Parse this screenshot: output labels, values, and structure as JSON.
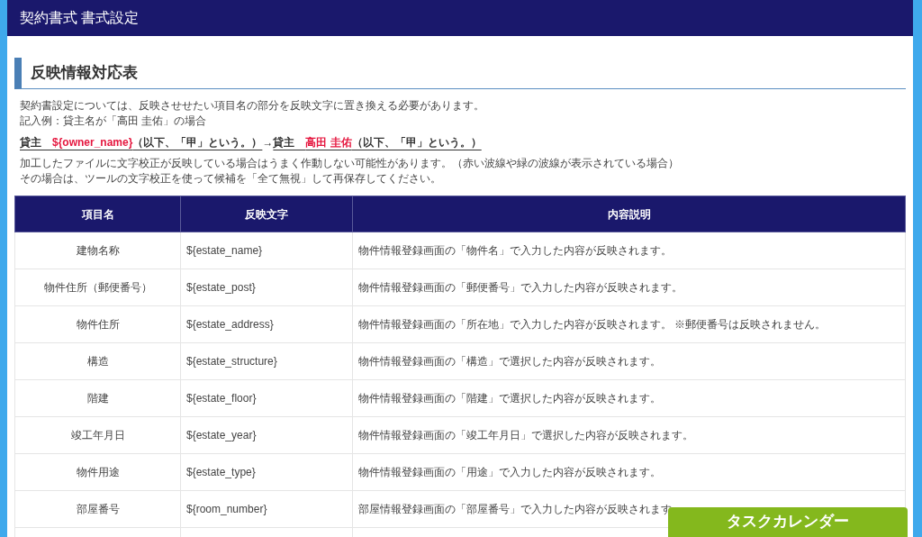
{
  "header": {
    "title": "契約書式 書式設定"
  },
  "section": {
    "title": "反映情報対応表"
  },
  "intro": [
    "契約書設定については、反映させせたい項目名の部分を反映文字に置き換える必要があります。",
    "記入例：貸主名が「高田 圭佑」の場合"
  ],
  "example": {
    "left": [
      {
        "text": "貸主　",
        "highlight": false
      },
      {
        "text": "${owner_name}",
        "highlight": true
      },
      {
        "text": "（以下、「甲」という。）",
        "highlight": false
      }
    ],
    "arrow": "→",
    "right": [
      {
        "text": "貸主　",
        "highlight": false
      },
      {
        "text": "高田 圭佑",
        "highlight": true
      },
      {
        "text": "（以下、「甲」という。）",
        "highlight": false
      }
    ]
  },
  "notes": [
    "加工したファイルに文字校正が反映している場合はうまく作動しない可能性があります。（赤い波線や緑の波線が表示されている場合）",
    "その場合は、ツールの文字校正を使って候補を「全て無視」して再保存してください。"
  ],
  "table": {
    "columns": [
      "項目名",
      "反映文字",
      "内容説明"
    ],
    "rows": [
      [
        "建物名称",
        "${estate_name}",
        "物件情報登録画面の「物件名」で入力した内容が反映されます。"
      ],
      [
        "物件住所（郵便番号）",
        "${estate_post}",
        "物件情報登録画面の「郵便番号」で入力した内容が反映されます。"
      ],
      [
        "物件住所",
        "${estate_address}",
        "物件情報登録画面の「所在地」で入力した内容が反映されます。 ※郵便番号は反映されません。"
      ],
      [
        "構造",
        "${estate_structure}",
        "物件情報登録画面の「構造」で選択した内容が反映されます。"
      ],
      [
        "階建",
        "${estate_floor}",
        "物件情報登録画面の「階建」で選択した内容が反映されます。"
      ],
      [
        "竣工年月日",
        "${estate_year}",
        "物件情報登録画面の「竣工年月日」で選択した内容が反映されます。"
      ],
      [
        "物件用途",
        "${estate_type}",
        "物件情報登録画面の「用途」で入力した内容が反映されます。"
      ],
      [
        "部屋番号",
        "${room_number}",
        "部屋情報登録画面の「部屋番号」で入力した内容が反映されます"
      ]
    ]
  },
  "floating_button": {
    "label": "タスクカレンダー"
  }
}
